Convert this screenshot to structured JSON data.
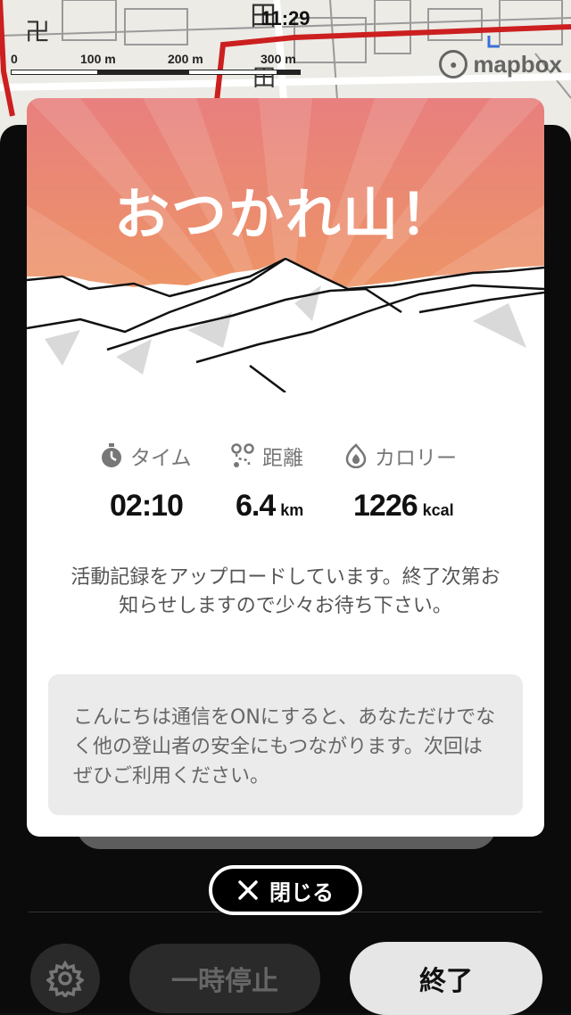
{
  "status_bar": {
    "time": "11:29"
  },
  "map": {
    "scale_labels": [
      "0",
      "100 m",
      "200 m",
      "300 m"
    ],
    "attribution": "mapbox",
    "attribution_icon": "mapbox-logo-icon"
  },
  "modal": {
    "title": "おつかれ山！",
    "stats": [
      {
        "icon": "stopwatch-icon",
        "label": "タイム",
        "value": "02:10",
        "unit": ""
      },
      {
        "icon": "route-icon",
        "label": "距離",
        "value": "6.4",
        "unit": "km"
      },
      {
        "icon": "flame-icon",
        "label": "カロリー",
        "value": "1226",
        "unit": "kcal"
      }
    ],
    "message": "活動記録をアップロードしています。終了次第お知らせしますので少々お待ち下さい。",
    "note": "こんにちは通信をONにすると、あなただけでなく他の登山者の安全にもつながります。次回はぜひご利用ください。"
  },
  "close_button": {
    "label": "閉じる",
    "icon": "close-icon"
  },
  "controls": {
    "settings_icon": "gear-icon",
    "pause_label": "一時停止",
    "end_label": "終了"
  },
  "colors": {
    "banner_top": "#e87f7e",
    "banner_bottom": "#f0a05a",
    "route_red": "#cc1f1f",
    "end_button_bg": "#e6e6e6"
  }
}
